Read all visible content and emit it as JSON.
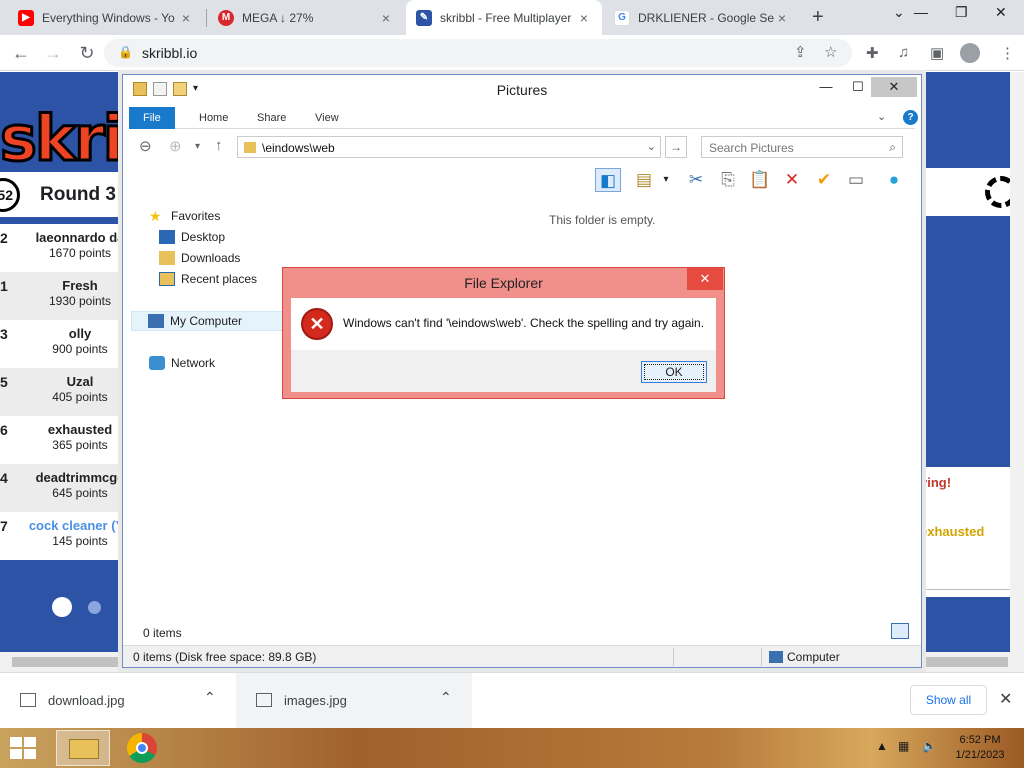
{
  "browser": {
    "tabs": [
      {
        "title": "Everything Windows - Yo",
        "favicon": "youtube-icon",
        "color": "#ff0000"
      },
      {
        "title": "MEGA ↓ 27%",
        "favicon": "mega-icon",
        "color": "#d9272e"
      },
      {
        "title": "skribbl - Free Multiplayer",
        "favicon": "skribbl-icon",
        "color": "#2c53a5"
      },
      {
        "title": "DRKLIENER - Google Sea",
        "favicon": "google-icon",
        "color": "#4285f4"
      }
    ],
    "url": "skribbl.io"
  },
  "game": {
    "round_label": "Round 3",
    "timer": "52",
    "players": [
      {
        "rank": "2",
        "name": "laeonnardo da",
        "points": "1670 points"
      },
      {
        "rank": "1",
        "name": "Fresh",
        "points": "1930 points"
      },
      {
        "rank": "3",
        "name": "olly",
        "points": "900 points"
      },
      {
        "rank": "5",
        "name": "Uzal",
        "points": "405 points"
      },
      {
        "rank": "6",
        "name": "exhausted",
        "points": "365 points"
      },
      {
        "rank": "4",
        "name": "deadtrimmcge",
        "points": "645 points"
      },
      {
        "rank": "7",
        "name": "cock cleaner (Yo",
        "points": "145 points",
        "highlight": true
      }
    ],
    "chat": [
      "ving!",
      "exhausted"
    ]
  },
  "explorer": {
    "title": "Pictures",
    "ribbon_tabs": [
      "File",
      "Home",
      "Share",
      "View"
    ],
    "address": "\\eindows\\web",
    "search_placeholder": "Search Pictures",
    "nav": {
      "favorites": "Favorites",
      "desktop": "Desktop",
      "downloads": "Downloads",
      "recent": "Recent places",
      "computer": "My Computer",
      "network": "Network"
    },
    "empty_text": "This folder is empty.",
    "item_count": "0 items",
    "status": "0 items (Disk free space: 89.8 GB)",
    "status_location": "Computer"
  },
  "dialog": {
    "title": "File Explorer",
    "message": "Windows can't find '\\eindows\\web'. Check the spelling and try again.",
    "ok_label": "OK"
  },
  "downloads": {
    "items": [
      "download.jpg",
      "images.jpg"
    ],
    "show_all": "Show all"
  },
  "taskbar": {
    "time": "6:52 PM",
    "date": "1/21/2023"
  }
}
